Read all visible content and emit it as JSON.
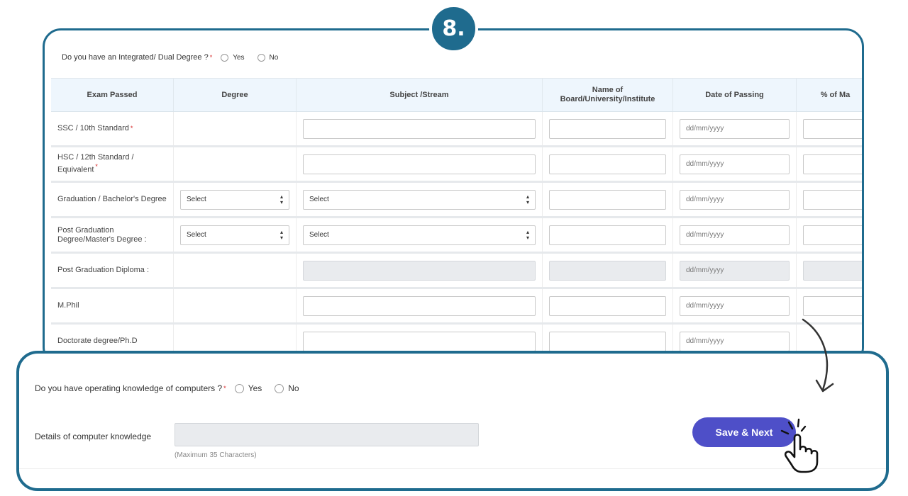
{
  "step": {
    "number": "8."
  },
  "dual_degree": {
    "question": "Do you have an Integrated/ Dual Degree ?",
    "required": "*",
    "yes": "Yes",
    "no": "No"
  },
  "table": {
    "headers": [
      "Exam Passed",
      "Degree",
      "Subject /Stream",
      "Name of Board/University/Institute",
      "Date of Passing",
      "% of Ma"
    ],
    "rows": [
      {
        "exam": "SSC / 10th Standard",
        "required": "*",
        "date_placeholder": "dd/mm/yyyy"
      },
      {
        "exam": "HSC / 12th Standard / Equivalent",
        "required": "*",
        "date_placeholder": "dd/mm/yyyy"
      },
      {
        "exam": "Graduation / Bachelor's Degree",
        "degree_select": "Select",
        "subject_select": "Select",
        "date_placeholder": "dd/mm/yyyy"
      },
      {
        "exam": "Post Graduation Degree/Master's Degree :",
        "degree_select": "Select",
        "subject_select": "Select",
        "date_placeholder": "dd/mm/yyyy"
      },
      {
        "exam": "Post Graduation Diploma :",
        "date_placeholder": "dd/mm/yyyy"
      },
      {
        "exam": "M.Phil",
        "date_placeholder": "dd/mm/yyyy"
      },
      {
        "exam": "Doctorate degree/Ph.D",
        "date_placeholder": "dd/mm/yyyy"
      }
    ]
  },
  "computer": {
    "question": "Do you have operating knowledge of computers ?",
    "required": "*",
    "yes": "Yes",
    "no": "No",
    "details_label": "Details of computer knowledge",
    "max_chars": "(Maximum 35 Characters)",
    "save_button": "Save & Next"
  },
  "colors": {
    "frame": "#1f6b8e",
    "button": "#4e4fc8",
    "header_bg": "#eef6fd",
    "required": "#d62828"
  },
  "icons": {
    "arrow": "curved-arrow-icon",
    "hand": "pointing-hand-icon"
  }
}
